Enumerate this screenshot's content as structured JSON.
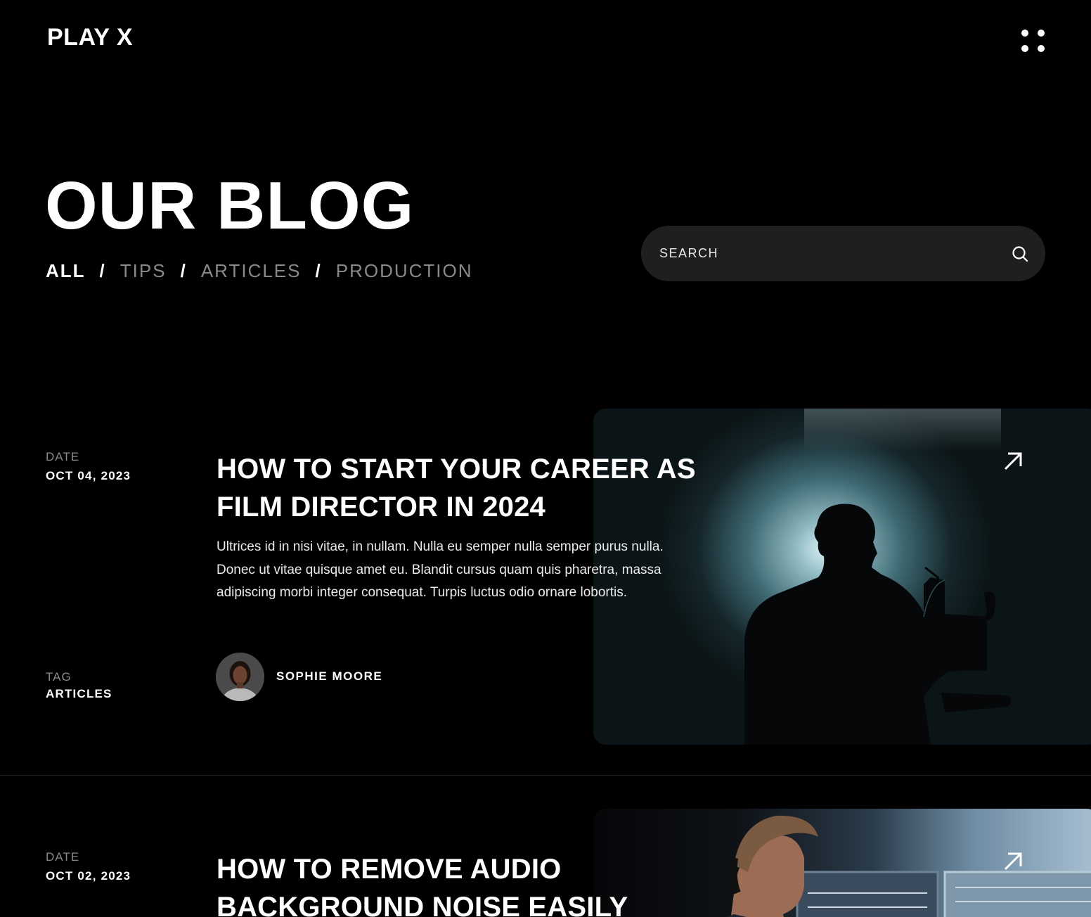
{
  "header": {
    "logo": "PLAY X",
    "menu_icon": "grid-dots-icon"
  },
  "hero": {
    "title": "OUR BLOG"
  },
  "filters": [
    {
      "label": "ALL",
      "active": true
    },
    {
      "label": "TIPS",
      "active": false
    },
    {
      "label": "ARTICLES",
      "active": false
    },
    {
      "label": "PRODUCTION",
      "active": false
    }
  ],
  "filter_separator": "/",
  "search": {
    "placeholder": "SEARCH",
    "icon": "search-icon"
  },
  "posts": [
    {
      "date_label": "DATE",
      "date": "OCT 04, 2023",
      "tag_label": "TAG",
      "tag": "ARTICLES",
      "title_line1": "HOW TO START YOUR CAREER AS",
      "title_line2": "FILM DIRECTOR IN 2024",
      "excerpt": "Ultrices id in nisi vitae, in nullam. Nulla eu semper nulla semper purus nulla. Donec ut vitae quisque amet eu. Blandit cursus quam quis pharetra, massa adipiscing morbi integer consequat. Turpis luctus odio ornare lobortis.",
      "author": "SOPHIE MOORE",
      "image": "silhouette of camera operator with backlight",
      "link_icon": "arrow-up-right-icon"
    },
    {
      "date_label": "DATE",
      "date": "OCT 02, 2023",
      "title_line1": "HOW TO REMOVE AUDIO",
      "title_line2": "BACKGROUND NOISE EASILY",
      "image": "sound engineer with headphones in studio",
      "link_icon": "arrow-up-right-icon"
    }
  ]
}
